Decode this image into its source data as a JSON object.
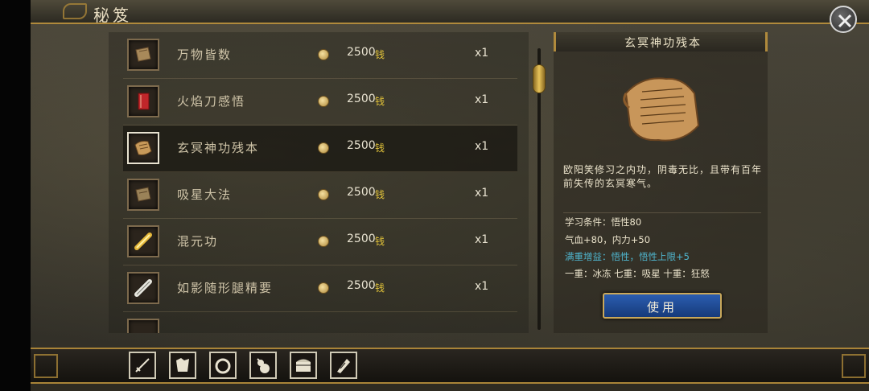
{
  "header": {
    "title": "秘笈"
  },
  "items": [
    {
      "name": "万物皆数",
      "price": "2500",
      "currency": "钱",
      "qty": "x1",
      "icon": "book-icon"
    },
    {
      "name": "火焰刀感悟",
      "price": "2500",
      "currency": "钱",
      "qty": "x1",
      "icon": "red-book-icon"
    },
    {
      "name": "玄冥神功残本",
      "price": "2500",
      "currency": "钱",
      "qty": "x1",
      "icon": "scroll-fragment-icon",
      "selected": true
    },
    {
      "name": "吸星大法",
      "price": "2500",
      "currency": "钱",
      "qty": "x1",
      "icon": "book-icon"
    },
    {
      "name": "混元功",
      "price": "2500",
      "currency": "钱",
      "qty": "x1",
      "icon": "golden-scroll-icon"
    },
    {
      "name": "如影随形腿精要",
      "price": "2500",
      "currency": "钱",
      "qty": "x1",
      "icon": "white-scroll-icon"
    }
  ],
  "detail": {
    "title": "玄冥神功残本",
    "description": "欧阳笑修习之内功，阴毒无比，且带有百年前失传的玄冥寒气。",
    "requirement": "学习条件：悟性80",
    "effect": "气血+80，内力+50",
    "bonus": "满重增益：悟性，悟性上限+5",
    "tiers": "一重：冰冻  七重：吸星  十重：狂怒",
    "use_label": "使用"
  },
  "tabs": [
    {
      "name": "weapon-tab",
      "icon": "sword-icon"
    },
    {
      "name": "armor-tab",
      "icon": "armor-icon"
    },
    {
      "name": "accessory-tab",
      "icon": "ring-icon"
    },
    {
      "name": "consumable-tab",
      "icon": "gourd-icon"
    },
    {
      "name": "treasure-tab",
      "icon": "chest-icon"
    },
    {
      "name": "manual-tab",
      "icon": "scroll-icon"
    }
  ],
  "colors": {
    "accent_gold": "#b08a3c",
    "currency_yellow": "#e3c43a",
    "bonus_cyan": "#4fb6cf",
    "button_blue": "#2b5db0"
  }
}
